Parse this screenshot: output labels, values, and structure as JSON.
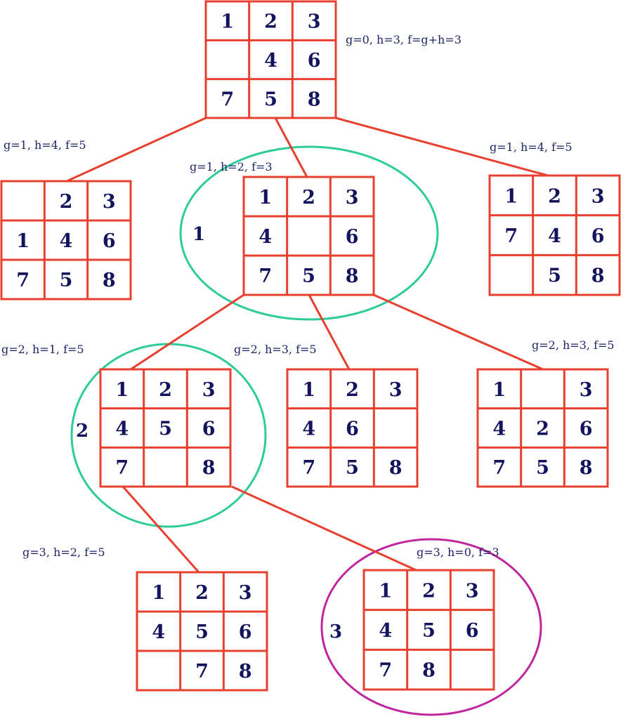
{
  "colors": {
    "grid": "#e8402f",
    "text": "#14145e",
    "path_highlight": "#2ecc9a",
    "goal_highlight": "#c0259e"
  },
  "nodes": {
    "root": {
      "board": [
        "1",
        "2",
        "3",
        "",
        "4",
        "6",
        "7",
        "5",
        "8"
      ],
      "label": "g=0, h=3, f=g+h=3"
    },
    "l1_left": {
      "board": [
        "",
        "2",
        "3",
        "1",
        "4",
        "6",
        "7",
        "5",
        "8"
      ],
      "label": "g=1, h=4, f=5"
    },
    "l1_mid": {
      "board": [
        "1",
        "2",
        "3",
        "4",
        "",
        "6",
        "7",
        "5",
        "8"
      ],
      "label": "g=1, h=2, f=3",
      "step": "1"
    },
    "l1_right": {
      "board": [
        "1",
        "2",
        "3",
        "7",
        "4",
        "6",
        "",
        "5",
        "8"
      ],
      "label": "g=1, h=4, f=5"
    },
    "l2_left": {
      "board": [
        "1",
        "2",
        "3",
        "4",
        "5",
        "6",
        "7",
        "",
        "8"
      ],
      "label": "g=2, h=1, f=5",
      "step": "2"
    },
    "l2_mid": {
      "board": [
        "1",
        "2",
        "3",
        "4",
        "6",
        "",
        "7",
        "5",
        "8"
      ],
      "label": "g=2, h=3, f=5"
    },
    "l2_right": {
      "board": [
        "1",
        "",
        "3",
        "4",
        "2",
        "6",
        "7",
        "5",
        "8"
      ],
      "label": "g=2, h=3, f=5"
    },
    "l3_left": {
      "board": [
        "1",
        "2",
        "3",
        "4",
        "5",
        "6",
        "",
        "7",
        "8"
      ],
      "label": "g=3, h=2, f=5"
    },
    "l3_goal": {
      "board": [
        "1",
        "2",
        "3",
        "4",
        "5",
        "6",
        "7",
        "8",
        ""
      ],
      "label": "g=3, h=0, f=3",
      "step": "3"
    }
  }
}
